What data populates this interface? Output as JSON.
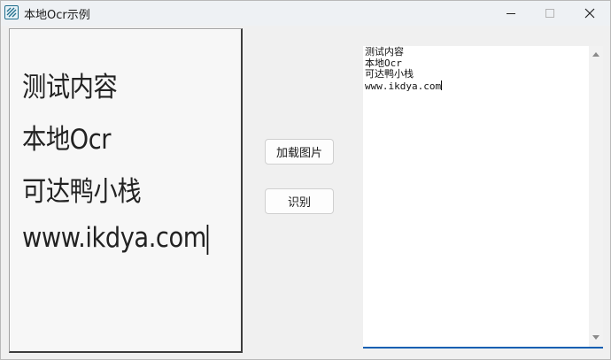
{
  "window": {
    "title": "本地Ocr示例",
    "icon": "app-icon"
  },
  "image_panel": {
    "lines": [
      "测试内容",
      "本地Ocr",
      "可达鸭小栈",
      "www.ikdya.com"
    ]
  },
  "buttons": {
    "load_label": "加载图片",
    "recognize_label": "识别"
  },
  "result": {
    "lines": [
      "测试内容",
      "本地Ocr",
      "可达鸭小栈",
      "www.ikdya.com"
    ]
  },
  "colors": {
    "accent": "#0b5fb2",
    "icon": "#1f6d8c"
  }
}
